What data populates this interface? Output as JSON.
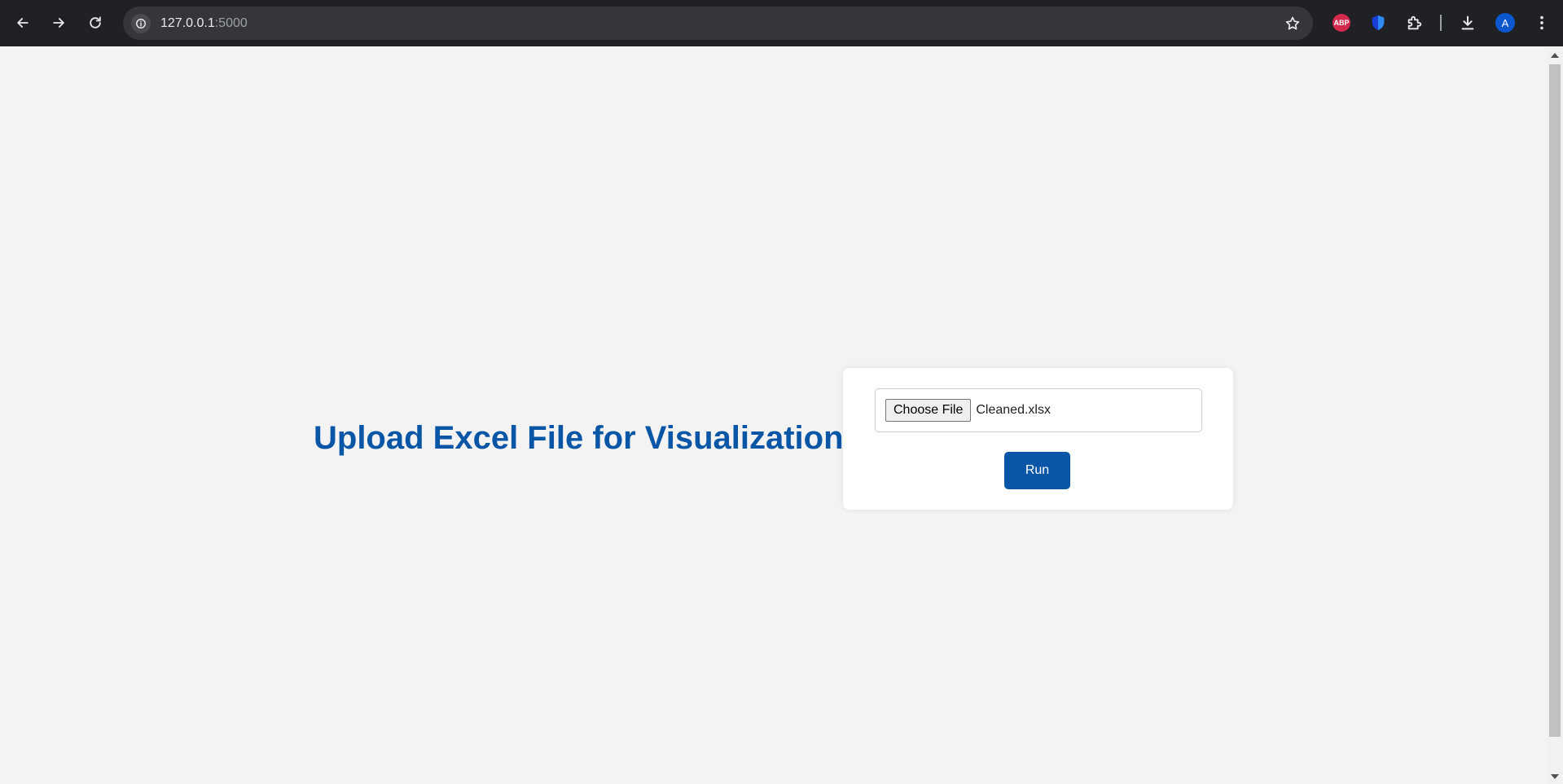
{
  "browser": {
    "url_host": "127.0.0.1",
    "url_port": ":5000",
    "icons": {
      "back": "back-arrow-icon",
      "forward": "forward-arrow-icon",
      "reload": "reload-icon",
      "site_info": "info-icon",
      "bookmark": "star-icon",
      "adblock": "abp-icon",
      "shield": "shield-icon",
      "extensions": "puzzle-icon",
      "downloads": "download-icon",
      "menu": "kebab-menu-icon"
    },
    "adblock_label": "ABP",
    "avatar_initial": "A"
  },
  "page": {
    "title": "Upload Excel File for Visualization",
    "file_input": {
      "button_label": "Choose File",
      "selected_file": "Cleaned.xlsx"
    },
    "run_button_label": "Run"
  },
  "colors": {
    "accent": "#0a56a6",
    "page_background": "#f3f3f3",
    "card_background": "#ffffff",
    "browser_chrome": "#202124"
  }
}
